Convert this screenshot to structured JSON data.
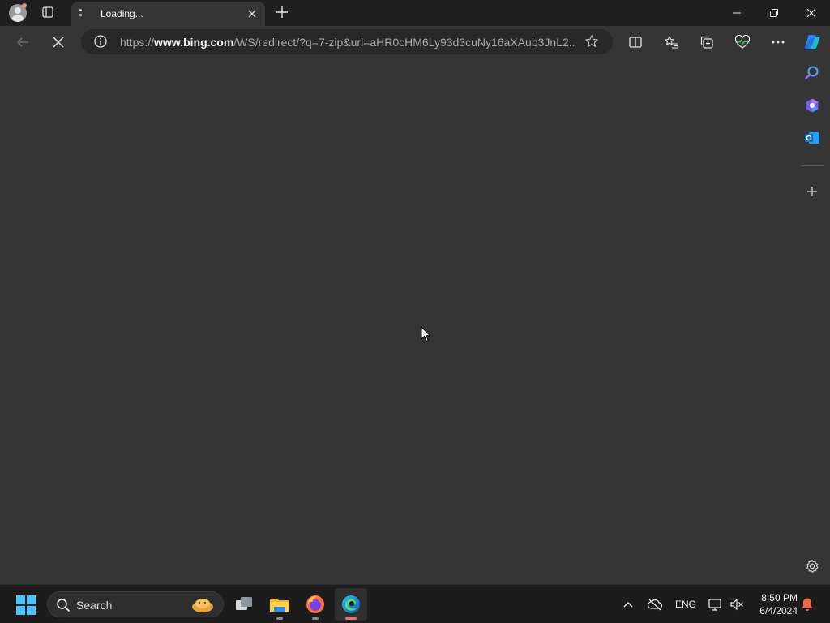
{
  "tab": {
    "title": "Loading..."
  },
  "address_bar": {
    "url_prefix": "https://",
    "url_host": "www.bing.com",
    "url_rest": "/WS/redirect/?q=7-zip&url=aHR0cHM6Ly93d3cuNy16aXAub3JnL2..."
  },
  "taskbar": {
    "search_label": "Search",
    "apps": [
      "file-explorer-icon",
      "firefox-icon",
      "edge-icon"
    ]
  },
  "tray": {
    "language": "ENG",
    "time": "8:50 PM",
    "date": "6/4/2024"
  },
  "colors": {
    "page_background": "#353535",
    "tab_strip": "#1f1f1f",
    "address_bar": "#282828",
    "taskbar": "#1c1c1c",
    "accent_windows": "#4cc2ff"
  }
}
